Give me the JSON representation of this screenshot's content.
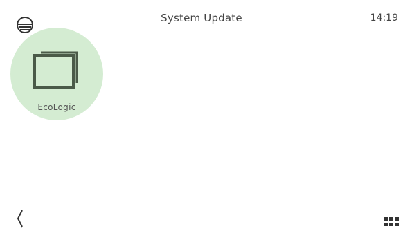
{
  "header": {
    "title": "System Update",
    "clock": "14:19",
    "status_icon": "layers-circle-icon"
  },
  "apps": [
    {
      "label": "EcoLogic",
      "icon": "frames-icon",
      "color": "#d4ecd2"
    }
  ],
  "footer": {
    "back_icon": "chevron-left-icon",
    "menu_icon": "grid-icon"
  },
  "colors": {
    "accent": "#d4ecd2",
    "icon_green": "#4a5a48",
    "text": "#444444"
  }
}
